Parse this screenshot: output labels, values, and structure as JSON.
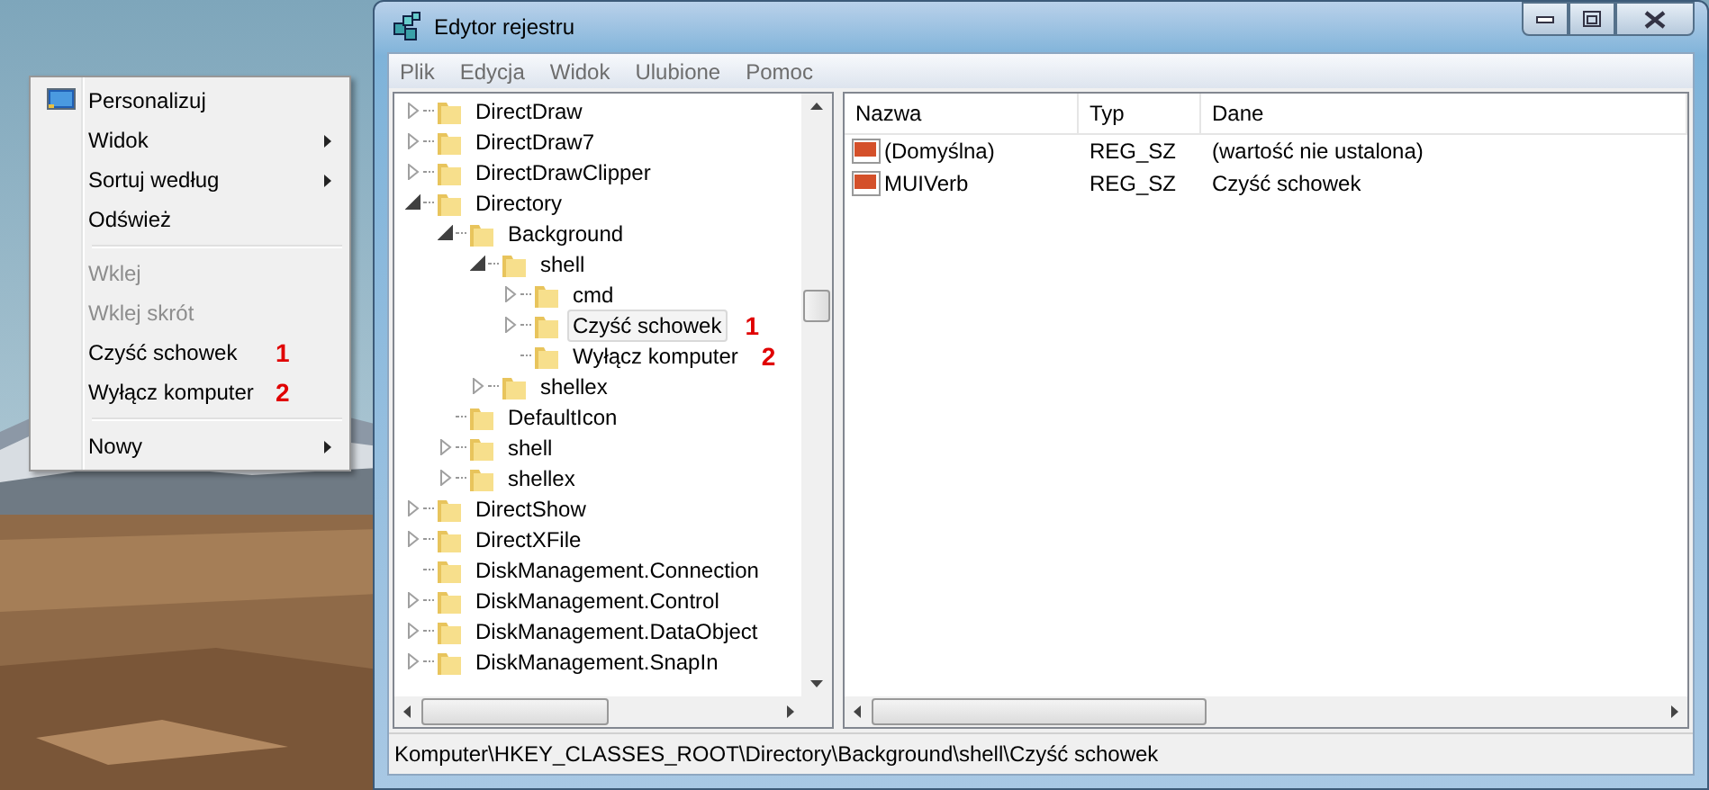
{
  "context_menu": {
    "items": [
      {
        "kind": "icon-item",
        "label": "Personalizuj",
        "disabled": false,
        "submenu": false
      },
      {
        "kind": "item",
        "label": "Widok",
        "disabled": false,
        "submenu": true
      },
      {
        "kind": "item",
        "label": "Sortuj według",
        "disabled": false,
        "submenu": true
      },
      {
        "kind": "item",
        "label": "Odśwież",
        "disabled": false,
        "submenu": false
      },
      {
        "kind": "separator"
      },
      {
        "kind": "item",
        "label": "Wklej",
        "disabled": true,
        "submenu": false
      },
      {
        "kind": "item",
        "label": "Wklej skrót",
        "disabled": true,
        "submenu": false
      },
      {
        "kind": "item",
        "label": "Czyść schowek",
        "disabled": false,
        "submenu": false,
        "marker": "1"
      },
      {
        "kind": "item",
        "label": "Wyłącz komputer",
        "disabled": false,
        "submenu": false,
        "marker": "2"
      },
      {
        "kind": "separator"
      },
      {
        "kind": "item",
        "label": "Nowy",
        "disabled": false,
        "submenu": true
      }
    ]
  },
  "window": {
    "title": "Edytor rejestru"
  },
  "menu_bar": [
    "Plik",
    "Edycja",
    "Widok",
    "Ulubione",
    "Pomoc"
  ],
  "tree": [
    {
      "label": "DirectDraw",
      "kind": "branch",
      "expanded": false,
      "selected": false
    },
    {
      "label": "DirectDraw7",
      "kind": "branch",
      "expanded": false,
      "selected": false
    },
    {
      "label": "DirectDrawClipper",
      "kind": "branch",
      "expanded": false,
      "selected": false
    },
    {
      "label": "Directory",
      "kind": "branch",
      "expanded": true,
      "selected": false,
      "children": [
        {
          "label": "Background",
          "kind": "branch",
          "expanded": true,
          "selected": false,
          "children": [
            {
              "label": "shell",
              "kind": "branch",
              "expanded": true,
              "selected": false,
              "children": [
                {
                  "label": "cmd",
                  "kind": "branch",
                  "expanded": false,
                  "selected": false
                },
                {
                  "label": "Czyść schowek",
                  "kind": "branch",
                  "expanded": false,
                  "selected": true,
                  "marker": "1"
                },
                {
                  "label": "Wyłącz komputer",
                  "kind": "leaf",
                  "selected": false,
                  "marker": "2"
                }
              ]
            },
            {
              "label": "shellex",
              "kind": "branch",
              "expanded": false,
              "selected": false
            }
          ]
        },
        {
          "label": "DefaultIcon",
          "kind": "leaf",
          "selected": false
        },
        {
          "label": "shell",
          "kind": "branch",
          "expanded": false,
          "selected": false
        },
        {
          "label": "shellex",
          "kind": "branch",
          "expanded": false,
          "selected": false
        }
      ]
    },
    {
      "label": "DirectShow",
      "kind": "branch",
      "expanded": false,
      "selected": false
    },
    {
      "label": "DirectXFile",
      "kind": "branch",
      "expanded": false,
      "selected": false
    },
    {
      "label": "DiskManagement.Connection",
      "kind": "leaf",
      "selected": false
    },
    {
      "label": "DiskManagement.Control",
      "kind": "branch",
      "expanded": false,
      "selected": false
    },
    {
      "label": "DiskManagement.DataObject",
      "kind": "branch",
      "expanded": false,
      "selected": false
    },
    {
      "label": "DiskManagement.SnapIn",
      "kind": "branch",
      "expanded": false,
      "selected": false
    }
  ],
  "values": {
    "columns": [
      "Nazwa",
      "Typ",
      "Dane"
    ],
    "rows": [
      {
        "name": "(Domyślna)",
        "type": "REG_SZ",
        "data": "(wartość nie ustalona)"
      },
      {
        "name": "MUIVerb",
        "type": "REG_SZ",
        "data": "Czyść schowek"
      }
    ]
  },
  "status_bar": "Komputer\\HKEY_CLASSES_ROOT\\Directory\\Background\\shell\\Czyść schowek"
}
